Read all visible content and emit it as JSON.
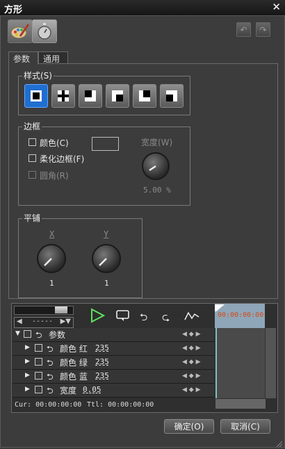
{
  "window": {
    "title": "方形",
    "close_glyph": "✕"
  },
  "tabs": [
    {
      "label": "参数"
    },
    {
      "label": "通用"
    }
  ],
  "style_group": {
    "label": "样式(S)",
    "items": [
      "style-border",
      "style-plus",
      "style-corner-br",
      "style-corner-tl",
      "style-corner-tr",
      "style-corner-bl"
    ]
  },
  "border_group": {
    "label": "边框",
    "color_label": "颜色(C)",
    "soft_label": "柔化边框(F)",
    "round_label": "圆角(R)",
    "width_label": "宽度(W)",
    "width_value": "5.00 %"
  },
  "tile_group": {
    "label": "平铺",
    "x_label": "X",
    "y_label": "Y",
    "x_value": "1",
    "y_value": "1"
  },
  "timeline": {
    "combo_value": "-----",
    "timecode": "00:00:00:00",
    "rows": [
      {
        "name": "参数",
        "value": ""
      },
      {
        "name": "颜色 红",
        "value": "235"
      },
      {
        "name": "颜色 绿",
        "value": "235"
      },
      {
        "name": "颜色 蓝",
        "value": "235"
      },
      {
        "name": "宽度",
        "value": "0.05"
      }
    ],
    "cur_label": "Cur: 00:00:00:00",
    "ttl_label": "Ttl: 00:00:00:00"
  },
  "buttons": {
    "ok": "确定(O)",
    "cancel": "取消(C)"
  },
  "colors": {
    "accent": "#1f6fd1",
    "play": "#5fe05f",
    "ruler": "#8fa6b8",
    "playhead": "#7fc0c8",
    "timecode": "#d24a1a"
  }
}
